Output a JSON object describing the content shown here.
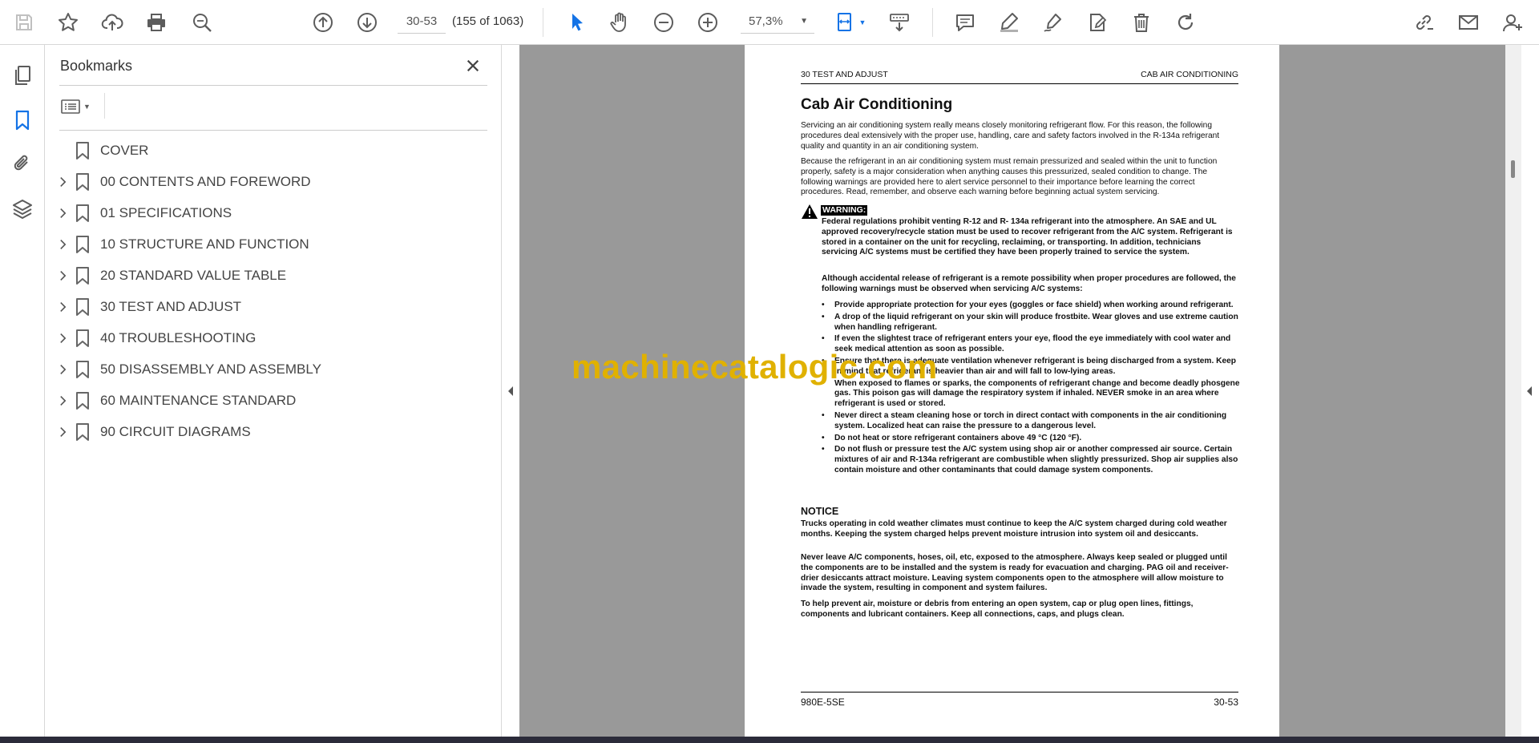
{
  "toolbar": {
    "page_current": "30-53",
    "page_count": "(155 of 1063)",
    "zoom": "57,3%"
  },
  "bookmarks_panel": {
    "title": "Bookmarks",
    "items": [
      {
        "label": "COVER",
        "expandable": false
      },
      {
        "label": "00 CONTENTS AND FOREWORD",
        "expandable": true
      },
      {
        "label": "01 SPECIFICATIONS",
        "expandable": true
      },
      {
        "label": "10 STRUCTURE AND FUNCTION",
        "expandable": true
      },
      {
        "label": "20 STANDARD VALUE TABLE",
        "expandable": true
      },
      {
        "label": "30 TEST AND ADJUST",
        "expandable": true
      },
      {
        "label": "40 TROUBLESHOOTING",
        "expandable": true
      },
      {
        "label": "50 DISASSEMBLY AND ASSEMBLY",
        "expandable": true
      },
      {
        "label": "60 MAINTENANCE STANDARD",
        "expandable": true
      },
      {
        "label": "90 CIRCUIT DIAGRAMS",
        "expandable": true
      }
    ]
  },
  "document": {
    "header_left": "30 TEST AND ADJUST",
    "header_right": "CAB AIR CONDITIONING",
    "title": "Cab Air Conditioning",
    "para1": "Servicing an air conditioning system really means closely monitoring refrigerant flow. For this reason, the following procedures deal extensively with the proper use, handling, care and safety factors involved in the R-134a refrigerant quality and quantity in an air conditioning system.",
    "para2": "Because the refrigerant in an air conditioning system must remain pressurized and sealed within the unit to function properly, safety is a major consideration when anything causes this pressurized, sealed condition to change. The following warnings are provided here to alert service personnel to their importance before learning the correct procedures. Read, remember, and observe each warning before beginning actual system servicing.",
    "warning_tag": "WARNING:",
    "warning1": "Federal regulations prohibit venting R-12 and R- 134a refrigerant into the atmosphere. An SAE and UL approved recovery/recycle station must be used to recover refrigerant from the A/C system. Refrigerant is stored in a container on the unit for recycling, reclaiming, or transporting. In addition, technicians servicing A/C systems must be certified they have been properly trained to service the system.",
    "warning2": "Although accidental release of refrigerant is a remote possibility when proper procedures are followed, the following warnings must be observed when servicing A/C systems:",
    "bullets": [
      "Provide appropriate protection for your eyes (goggles or face shield) when working around refrigerant.",
      "A drop of the liquid refrigerant on your skin will produce frostbite. Wear gloves and use extreme caution when handling refrigerant.",
      "If even the slightest trace of refrigerant enters your eye, flood the eye immediately with cool water and seek medical attention as soon as possible.",
      "Ensure that there is adequate ventilation whenever refrigerant is being discharged from a system. Keep in mind that refrigerant is heavier than air and will fall to low-lying areas.",
      "When exposed to flames or sparks, the components of refrigerant change and become deadly phosgene gas. This poison gas will damage the respiratory system if inhaled. NEVER smoke in an area where refrigerant is used or stored.",
      "Never direct a steam cleaning hose or torch in direct contact with components in the air conditioning system. Localized heat can raise the pressure to a dangerous level.",
      "Do not heat or store refrigerant containers above 49 °C (120 °F).",
      "Do not flush or pressure test the A/C system using shop air or another compressed air source. Certain mixtures of air and R-134a refrigerant are combustible when slightly pressurized. Shop air supplies also contain moisture and other contaminants that could damage system components."
    ],
    "notice_heading": "NOTICE",
    "notice1": "Trucks operating in cold weather climates must continue to keep the A/C system charged during cold weather months. Keeping the system charged helps prevent moisture intrusion into system oil and desiccants.",
    "notice2": "Never leave A/C components, hoses, oil, etc, exposed to the atmosphere. Always keep sealed or plugged until the components are to be installed and the system is ready for evacuation and charging. PAG oil and receiver-drier desiccants attract moisture. Leaving system components open to the atmosphere will allow moisture to invade the system, resulting in component and system failures.",
    "notice3": "To help prevent air, moisture or debris from entering an open system, cap or plug open lines, fittings, components and lubricant containers. Keep all connections, caps, and plugs clean.",
    "footer_left": "980E-5SE",
    "footer_right": "30-53"
  },
  "watermark": "machinecatalogic.com",
  "colors": {
    "accent_blue": "#1473e6",
    "icon_gray": "#5c5c5c",
    "watermark": "#e0b100"
  }
}
